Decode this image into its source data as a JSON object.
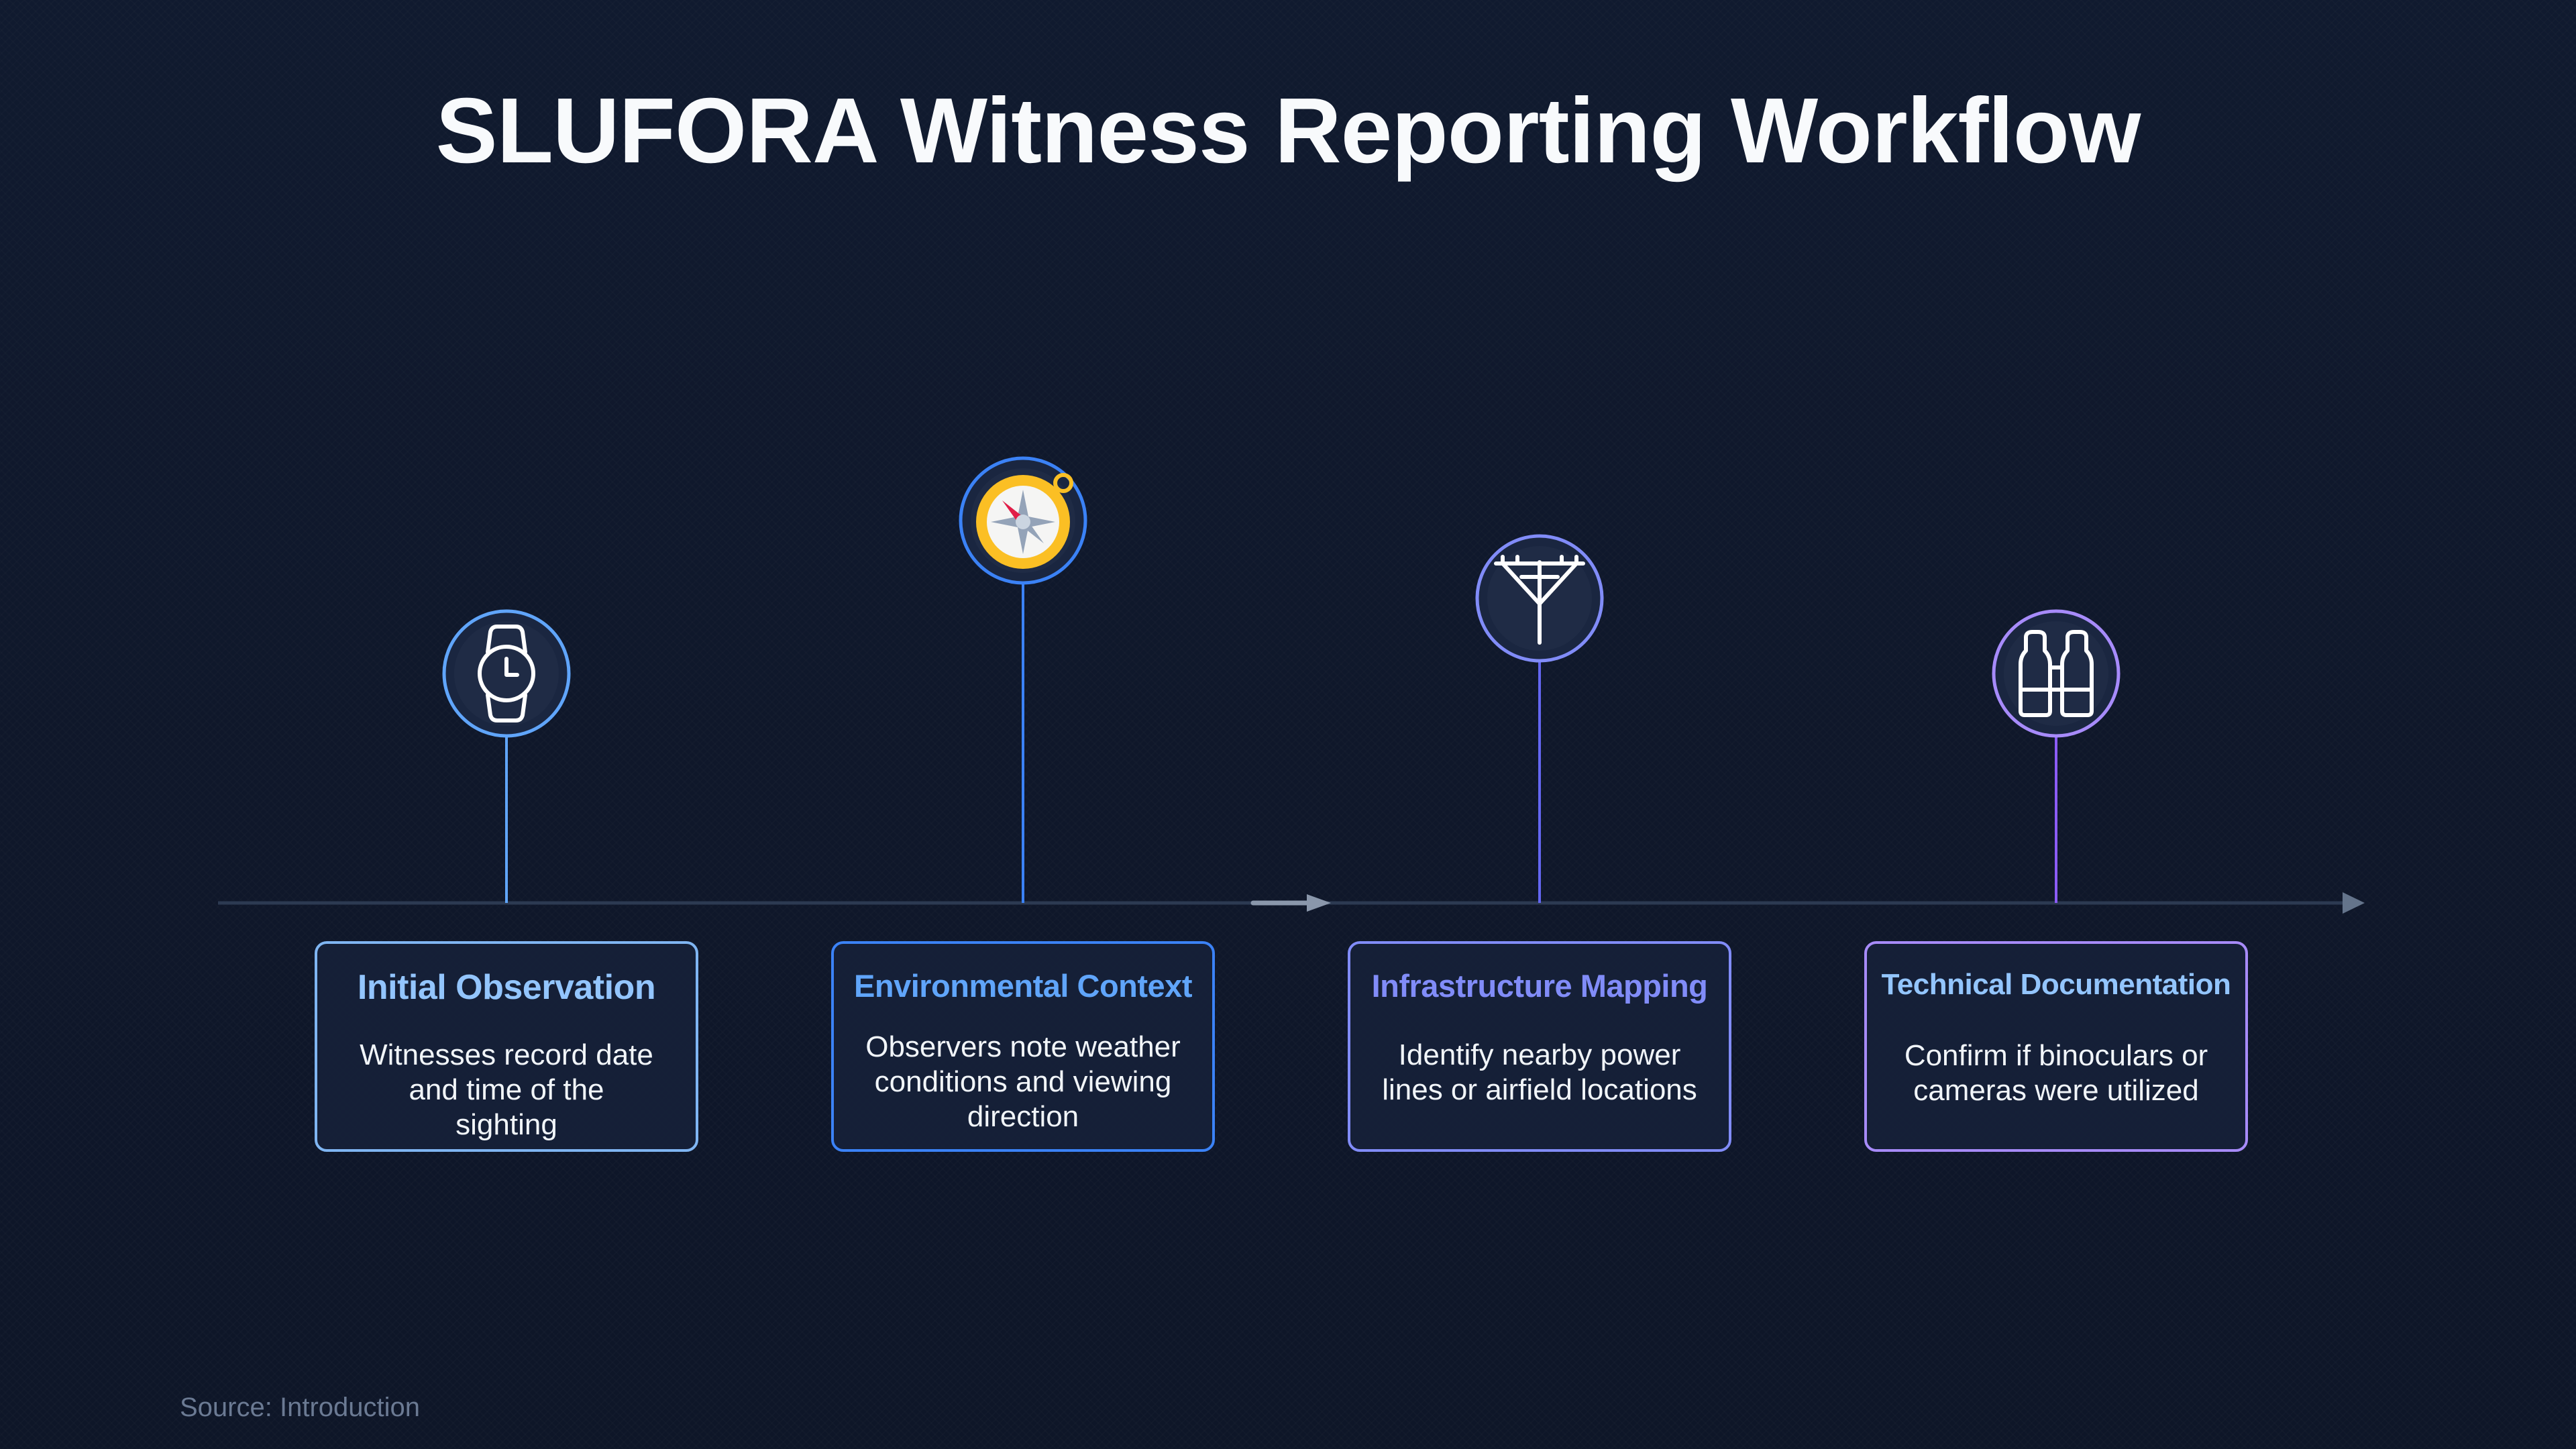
{
  "title": "SLUFORA Witness Reporting Workflow",
  "steps": [
    {
      "title": "Initial Observation",
      "description": "Witnesses record date and time of the sighting",
      "icon": "wristwatch-icon",
      "accent": "#60a5fa"
    },
    {
      "title": "Environmental Context",
      "description": "Observers note weather conditions and viewing direction",
      "icon": "compass-icon",
      "accent": "#3b82f6"
    },
    {
      "title": "Infrastructure Mapping",
      "description": "Identify nearby power lines or airfield locations",
      "icon": "power-pole-icon",
      "accent": "#818cf8"
    },
    {
      "title": "Technical Documentation",
      "description": "Confirm if binoculars or cameras were utilized",
      "icon": "binoculars-icon",
      "accent": "#a78bfa"
    }
  ],
  "source": "Source: Introduction",
  "colors": {
    "background": "#0f172a",
    "timeline": "#334155",
    "compass_gold": "#fbbf24",
    "compass_needle_red": "#e11d48"
  }
}
